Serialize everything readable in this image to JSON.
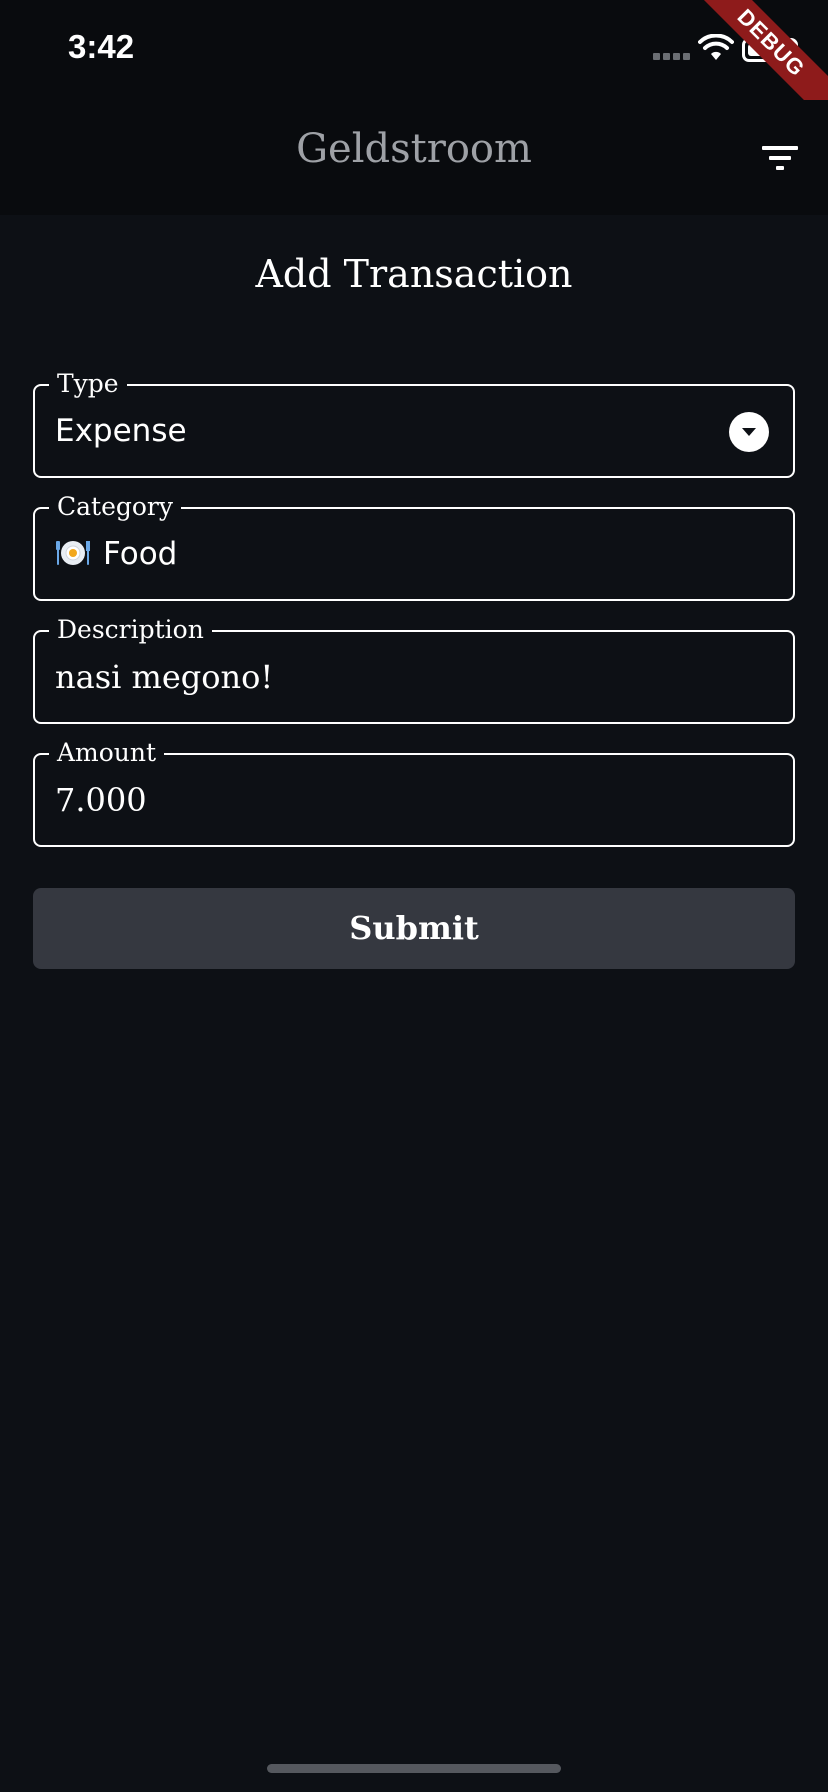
{
  "status_bar": {
    "time": "3:42"
  },
  "debug_banner": {
    "label": "DEBUG"
  },
  "app_bar": {
    "title": "Geldstroom",
    "filter_icon": "filter-icon"
  },
  "page": {
    "title": "Add Transaction"
  },
  "form": {
    "type": {
      "label": "Type",
      "value": "Expense"
    },
    "category": {
      "label": "Category",
      "value": "Food",
      "icon": "plate-fork-knife-icon"
    },
    "description": {
      "label": "Description",
      "value": "nasi megono!"
    },
    "amount": {
      "label": "Amount",
      "value": "7.000"
    },
    "submit_label": "Submit"
  },
  "colors": {
    "background": "#0d1015",
    "app_bar": "#090b0e",
    "button": "#353840",
    "debug_ribbon": "#8e1b1b"
  }
}
